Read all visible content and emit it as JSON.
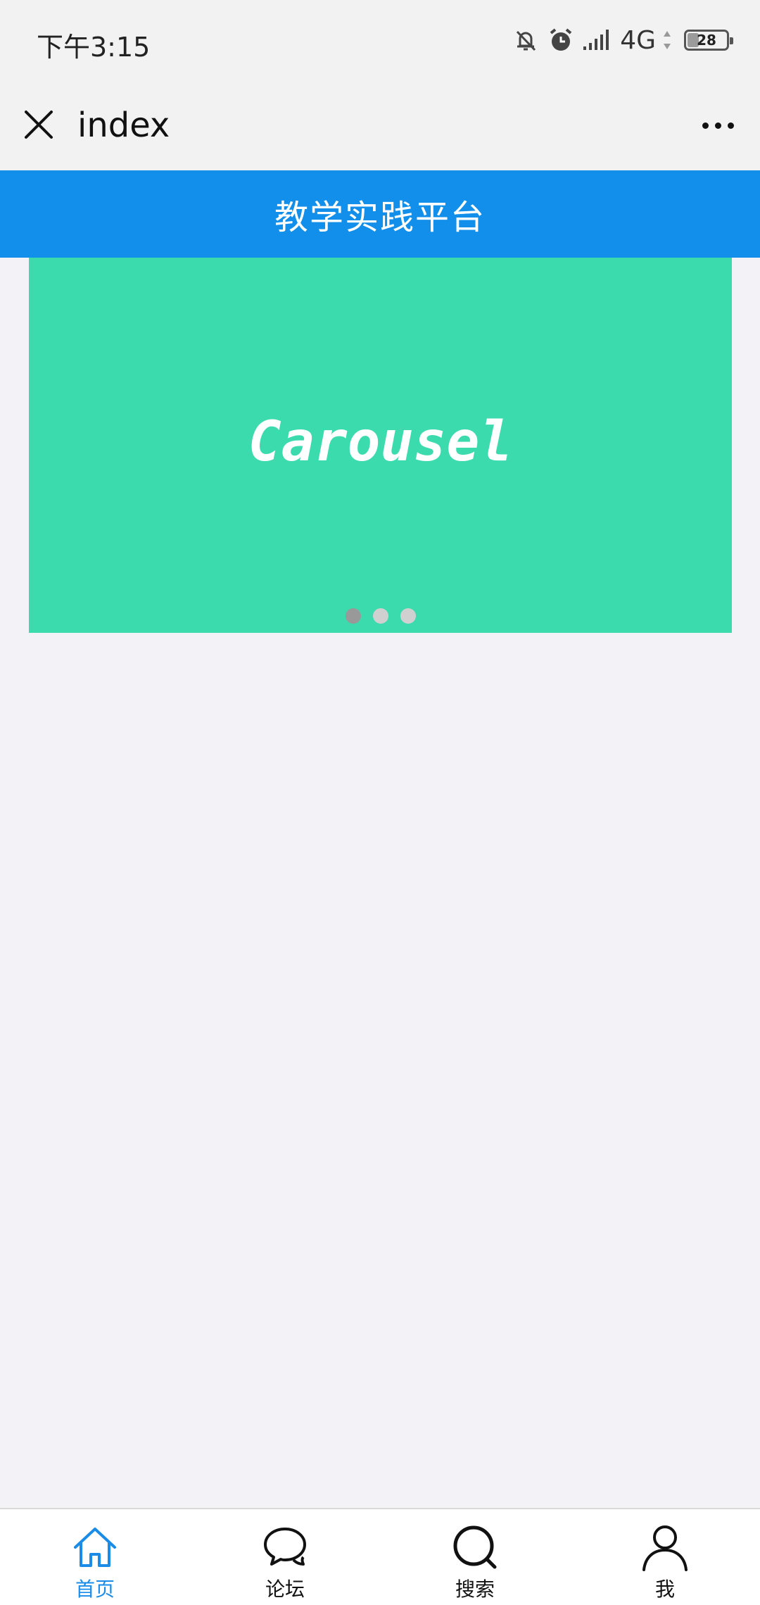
{
  "status_bar": {
    "time": "下午3:15",
    "network": "4G",
    "battery": "28",
    "battery_level": 0.28,
    "icons": [
      "bell-mute-icon",
      "alarm-icon",
      "signal-icon",
      "battery-icon"
    ]
  },
  "nav_bar": {
    "title": "index",
    "close_icon": "close-icon",
    "more_icon": "more-icon"
  },
  "header": {
    "title": "教学实践平台",
    "color": "#128eeb"
  },
  "carousel": {
    "label": "Carousel",
    "background": "#3cdbae",
    "slide_count": 3,
    "active_index": 0
  },
  "tab_bar": {
    "items": [
      {
        "label": "首页",
        "icon": "home-icon",
        "active": true
      },
      {
        "label": "论坛",
        "icon": "chat-icon",
        "active": false
      },
      {
        "label": "搜索",
        "icon": "search-icon",
        "active": false
      },
      {
        "label": "我",
        "icon": "user-icon",
        "active": false
      }
    ],
    "active_color": "#1a8ce8"
  }
}
